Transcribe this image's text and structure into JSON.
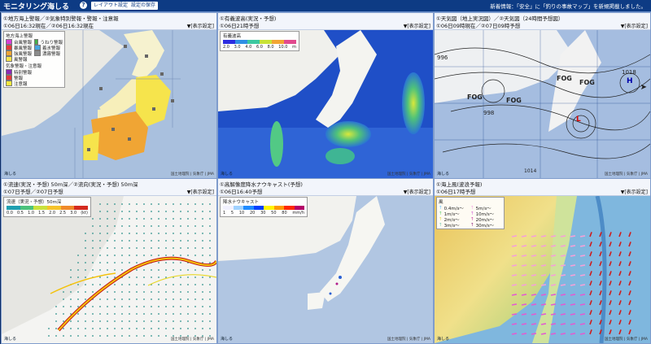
{
  "app": {
    "title": "モニタリング海しる",
    "layout_btn": "レイアウト設定",
    "save_btn": "設定の保存",
    "notice": "新着情報：「安全」に「釣りの事故マップ」を新規掲載しました。"
  },
  "panels": {
    "p1": {
      "title": "①地方海上警報／②気象特別警報・警報・注意報",
      "time": "①06日16:32現在／②06日16:32現在",
      "display": "▼[表示設定]",
      "legend_a_title": "地方海上警報",
      "legend_a": [
        {
          "label": "台風警報",
          "color": "#d63fd6"
        },
        {
          "label": "うねり警報",
          "color": "#46b04a"
        },
        {
          "label": "暴風警報",
          "color": "#e43a3a"
        },
        {
          "label": "着氷警報",
          "color": "#49a6e0"
        },
        {
          "label": "強風警報",
          "color": "#f0a534"
        },
        {
          "label": "濃霧警報",
          "color": "#8c8c8c"
        },
        {
          "label": "風警報",
          "color": "#f6e44c"
        }
      ],
      "legend_b_title": "気象警報・注意報",
      "legend_b": [
        {
          "label": "特別警報",
          "color": "#8a2ab5"
        },
        {
          "label": "警報",
          "color": "#e23a3a"
        },
        {
          "label": "注意報",
          "color": "#f3e93e"
        }
      ]
    },
    "p2": {
      "title": "①有義波高(実況・予想)",
      "time": "①06日21時予想",
      "display": "▼[表示設定]",
      "cb_title": "有義波高",
      "cb_ticks": [
        "2.0",
        "3.0",
        "4.0",
        "6.0",
        "8.0",
        "10.0",
        "m"
      ]
    },
    "p3": {
      "title": "①天気図（地上実況図）／②天気図（24時間予想図）",
      "time": "①06日09時現在／②07日09時予想",
      "display": "▼[表示設定]",
      "labels": [
        "FOG",
        "FOG",
        "FOG",
        "FOG",
        "1018",
        "996",
        "998",
        "1014",
        "L",
        "H"
      ]
    },
    "p4": {
      "title": "①流速(実況・予想) 50m深／②流向(実況・予想) 50m深",
      "time": "①07日予想／②07日予想",
      "display": "▼[表示設定]",
      "cb_title": "流速（実況・予想）50m深",
      "cb_ticks": [
        "0.0",
        "0.5",
        "1.0",
        "1.5",
        "2.0",
        "2.5",
        "3.0",
        "(kt)"
      ]
    },
    "p5": {
      "title": "①高解像度降水ナウキャスト(予想)",
      "time": "①06日16:40予想",
      "display": "▼[表示設定]",
      "cb_title": "降水ナウキャスト",
      "cb_ticks": [
        "1",
        "5",
        "10",
        "20",
        "30",
        "50",
        "80",
        "mm/h"
      ]
    },
    "p6": {
      "title": "①海上風(波浪予報)",
      "time": "①06日17時予想",
      "display": "▼[表示設定]",
      "legend_title": "風",
      "legend": [
        "0.4m/s～",
        "5m/s～",
        "1m/s～",
        "10m/s～",
        "2m/s～",
        "20m/s～",
        "3m/s～",
        "30m/s～"
      ]
    }
  },
  "common": {
    "credit": "国土地理院 | 気象庁 | JMA",
    "scale": "海しる"
  },
  "colors": {
    "land": "#f4f3ef",
    "sea": "#a7bdd9",
    "accent": "#0d3b84"
  }
}
